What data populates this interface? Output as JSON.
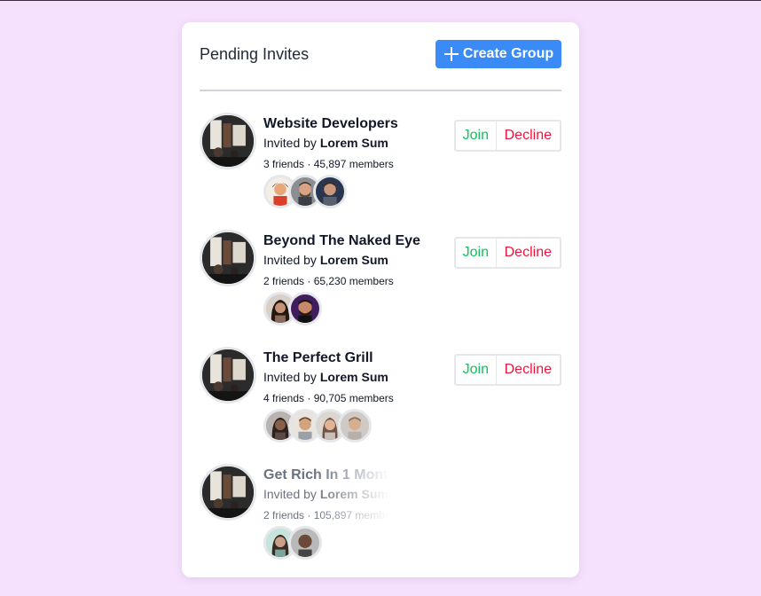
{
  "header": {
    "title": "Pending Invites",
    "create_label": "Create Group"
  },
  "actions": {
    "join_label": "Join",
    "decline_label": "Decline"
  },
  "groups": [
    {
      "name": "Website Developers",
      "invited_prefix": "Invited by",
      "inviter": "Lorem Sum",
      "stats": "3 friends · 45,897 members",
      "friend_count": 3,
      "has_actions": true
    },
    {
      "name": "Beyond The Naked Eye",
      "invited_prefix": "Invited by",
      "inviter": "Lorem Sum",
      "stats": "2 friends · 65,230 members",
      "friend_count": 2,
      "has_actions": true
    },
    {
      "name": "The Perfect Grill",
      "invited_prefix": "Invited by",
      "inviter": "Lorem Sum",
      "stats": "4 friends · 90,705 members",
      "friend_count": 4,
      "has_actions": true
    },
    {
      "name": "Get Rich In 1 Month",
      "invited_prefix": "Invited by",
      "inviter": "Lorem Sum",
      "stats": "2 friends · 105,897 members",
      "friend_count": 2,
      "has_actions": false
    }
  ],
  "colors": {
    "page_bg": "#f5e1fd",
    "primary": "#3b8bf6",
    "join": "#10c25b",
    "decline": "#f0143c"
  }
}
